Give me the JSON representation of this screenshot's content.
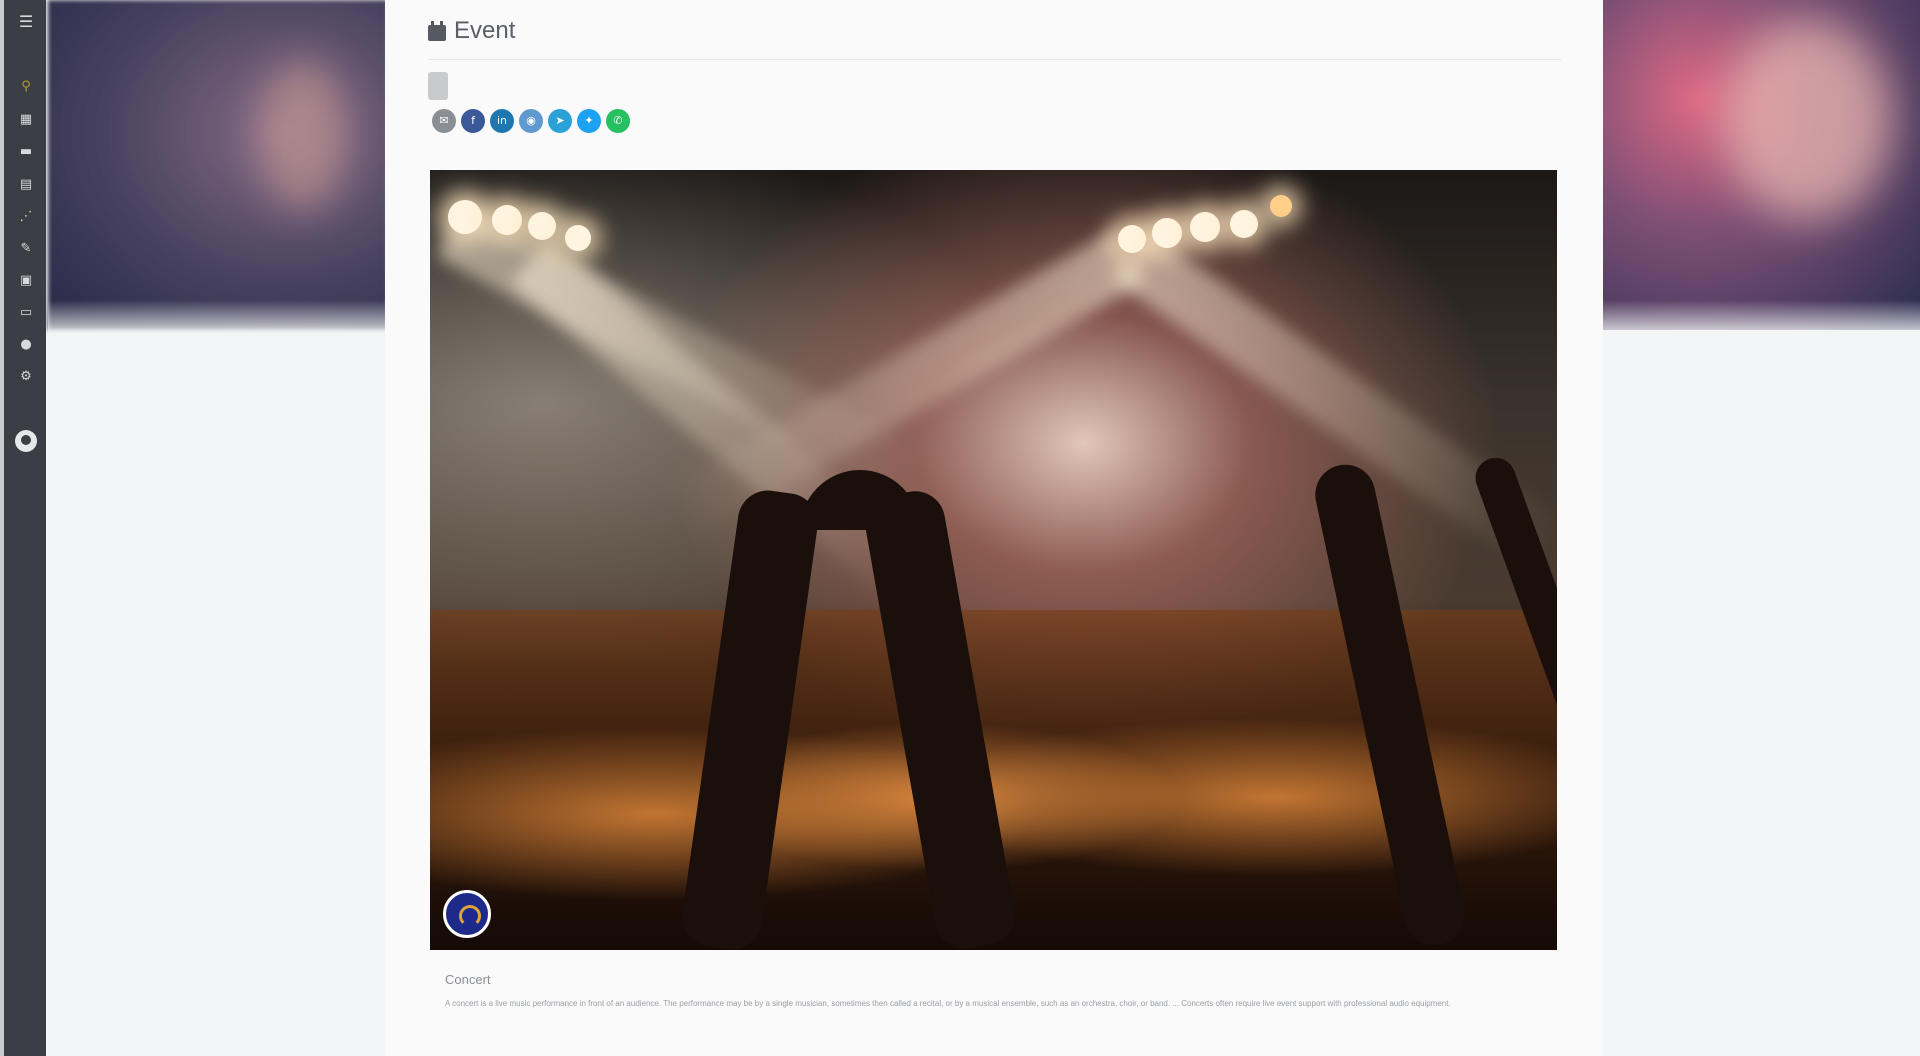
{
  "page": {
    "title": "Event"
  },
  "sidebar": {
    "items": [
      {
        "icon": "menu-icon"
      },
      {
        "icon": "search-icon"
      },
      {
        "icon": "calendar-icon"
      },
      {
        "icon": "chat-icon"
      },
      {
        "icon": "clipboard-icon"
      },
      {
        "icon": "chart-icon"
      },
      {
        "icon": "edit-icon"
      },
      {
        "icon": "inbox-icon"
      },
      {
        "icon": "card-icon"
      },
      {
        "icon": "globe-icon"
      },
      {
        "icon": "gear-icon"
      },
      {
        "icon": "github-icon"
      }
    ]
  },
  "event": {
    "tag_label": "",
    "share_buttons": [
      {
        "icon": "email-icon",
        "color": "#8a8f95"
      },
      {
        "icon": "facebook-icon",
        "color": "#3b5998"
      },
      {
        "icon": "linkedin-icon",
        "color": "#1f77b0"
      },
      {
        "icon": "reddit-icon",
        "color": "#5f99cf"
      },
      {
        "icon": "telegram-icon",
        "color": "#2aa2d8"
      },
      {
        "icon": "twitter-icon",
        "color": "#1da1f2"
      },
      {
        "icon": "whatsapp-icon",
        "color": "#25c05f"
      }
    ],
    "image_description_icon": "avatar-icon",
    "caption_title": "Concert",
    "caption_text": "A concert is a live music performance in front of an audience. The performance may be by a single musician, sometimes then called a recital, or by a musical ensemble, such as an orchestra, choir, or band. ... Concerts often require live event support with professional audio equipment."
  }
}
